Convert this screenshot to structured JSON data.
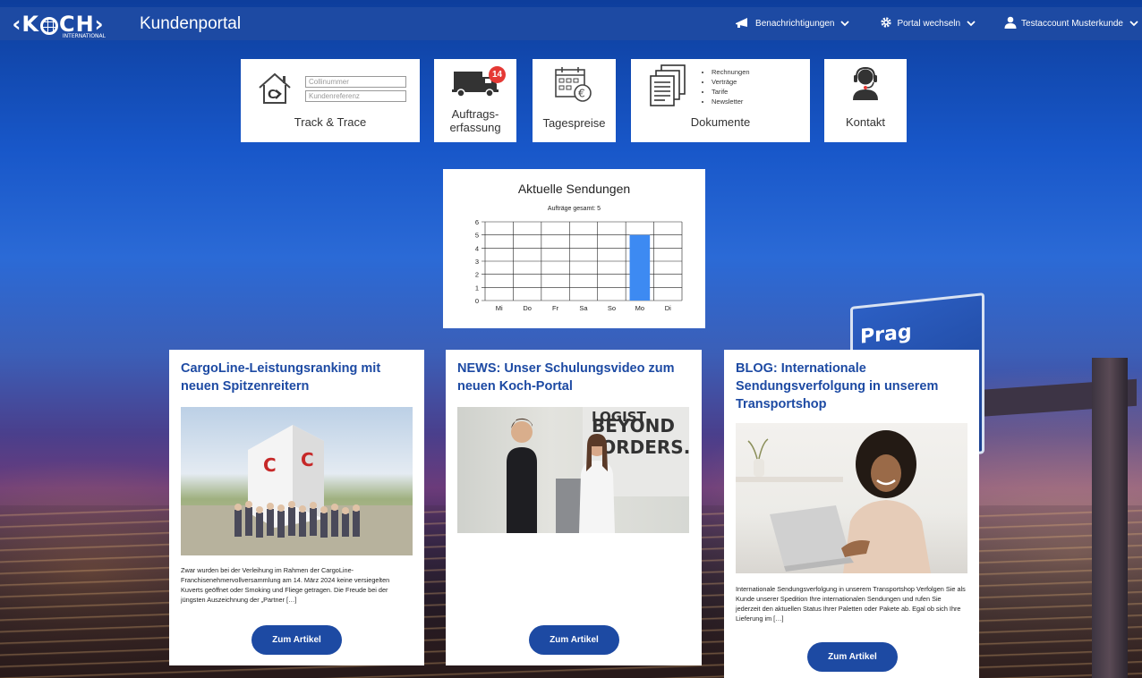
{
  "header": {
    "logo_text": "K",
    "logo_text_end": "CH",
    "logo_sub": "INTERNATIONAL",
    "title": "Kundenportal",
    "nav": [
      {
        "label": "Benachrichtigungen",
        "icon": "megaphone-icon"
      },
      {
        "label": "Portal wechseln",
        "icon": "gear-icon"
      },
      {
        "label": "Testaccount Musterkunde",
        "icon": "user-icon"
      }
    ]
  },
  "tiles": {
    "track_trace": {
      "title": "Track & Trace",
      "collinummer_placeholder": "Collinummer",
      "kundenreferenz_placeholder": "Kundenreferenz"
    },
    "auftrag": {
      "title_line1": "Auftrags-",
      "title_line2": "erfassung",
      "badge": "14"
    },
    "tagespreise": {
      "title": "Tagespreise"
    },
    "dokumente": {
      "title": "Dokumente",
      "items": [
        "Rechnungen",
        "Verträge",
        "Tarife",
        "Newsletter"
      ]
    },
    "kontakt": {
      "title": "Kontakt"
    }
  },
  "chart_card": {
    "title": "Aktuelle Sendungen",
    "subtitle": "Aufträge gesamt: 5"
  },
  "chart_data": {
    "type": "bar",
    "categories": [
      "Mi",
      "Do",
      "Fr",
      "Sa",
      "So",
      "Mo",
      "Di"
    ],
    "values": [
      0,
      0,
      0,
      0,
      0,
      5,
      0
    ],
    "title": "Aktuelle Sendungen",
    "subtitle": "Aufträge gesamt: 5",
    "xlabel": "",
    "ylabel": "",
    "ylim": [
      0,
      6
    ],
    "yticks": [
      0,
      1,
      2,
      3,
      4,
      5,
      6
    ],
    "grid": true,
    "bar_color": "#3d8af2"
  },
  "cards": [
    {
      "title": "CargoLine-Leistungsranking mit neuen Spitzenreitern",
      "text": "Zwar wurden bei der Verleihung im Rahmen der CargoLine-Franchisenehmervollversammlung am 14. März 2024 keine versiegelten Kuverts geöffnet oder Smoking und Fliege getragen. Die Freude bei der jüngsten Auszeichnung der „Partner […]",
      "button": "Zum Artikel"
    },
    {
      "title": "NEWS: Unser Schulungsvideo zum neuen Koch-Portal",
      "photo_text_1": "LOGIST",
      "photo_text_2": "BEYOND",
      "photo_text_3": "BORDERS.",
      "text": "",
      "button": "Zum Artikel"
    },
    {
      "title": "BLOG: Internationale Sendungsverfolgung in unserem Transportshop",
      "text": "Internationale Sendungsverfolgung in unserem Transportshop Verfolgen Sie als Kunde unserer Spedition Ihre internationalen Sendungen und rufen Sie jederzeit den aktuellen Status Ihrer Paletten oder Pakete ab. Egal ob sich Ihre Lieferung im […]",
      "button": "Zum Artikel"
    }
  ],
  "background": {
    "sign_text": "Prag"
  },
  "colors": {
    "brand_blue": "#1d4aa3",
    "badge_red": "#e53935"
  }
}
